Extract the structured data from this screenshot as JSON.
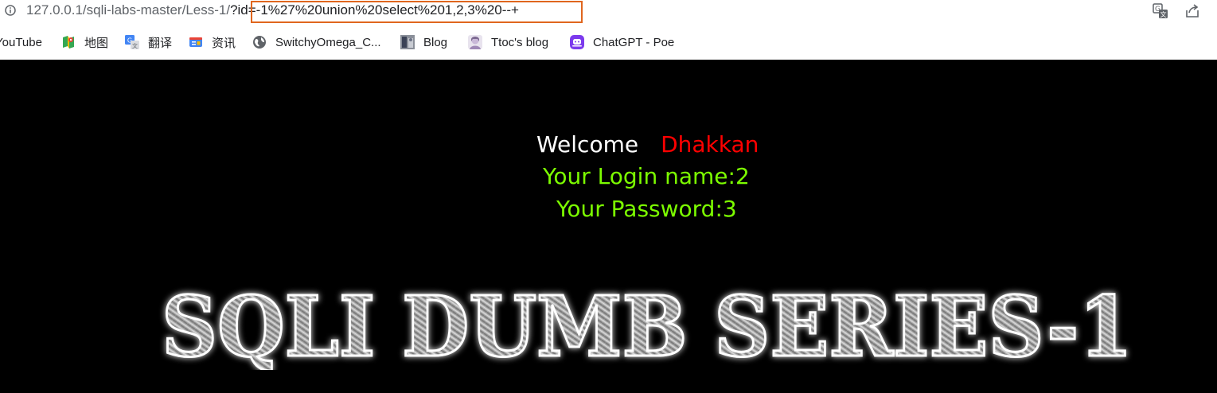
{
  "browser": {
    "url_base": "127.0.0.1/sqli-labs-master/Less-1/",
    "url_query": "?id=-1%27%20union%20select%201,2,3%20--+",
    "icons": {
      "site_info": "info-icon",
      "translate": "translate-icon",
      "share": "share-icon"
    },
    "highlight_color": "#e0661e"
  },
  "bookmarks": [
    {
      "label": "YouTube",
      "icon": "youtube-icon"
    },
    {
      "label": "地图",
      "icon": "maps-icon"
    },
    {
      "label": "翻译",
      "icon": "translate-bookmark-icon"
    },
    {
      "label": "资讯",
      "icon": "news-icon"
    },
    {
      "label": "SwitchyOmega_C...",
      "icon": "globe-icon"
    },
    {
      "label": "Blog",
      "icon": "blog-icon"
    },
    {
      "label": "Ttoc's blog",
      "icon": "ttoc-avatar-icon"
    },
    {
      "label": "ChatGPT - Poe",
      "icon": "poe-icon"
    }
  ],
  "page": {
    "welcome": "Welcome",
    "user": "Dhakkan",
    "login_name": "Your Login name:2",
    "password": "Your Password:3",
    "banner_text": "SQLI DUMB SERIES-1",
    "colors": {
      "background": "#000000",
      "welcome": "#ffffff",
      "user": "#ff0000",
      "result": "#7cfc00"
    }
  }
}
